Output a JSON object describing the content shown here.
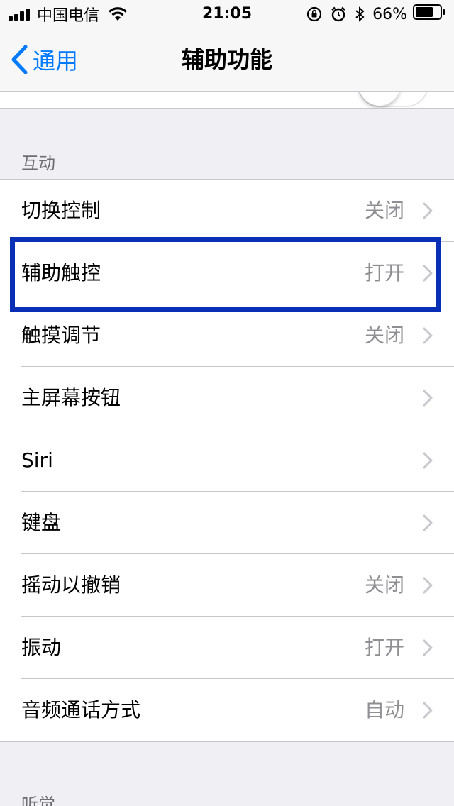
{
  "status_bar": {
    "carrier": "中国电信",
    "time": "21:05",
    "battery_percent": "66%",
    "icons": [
      "signal-icon",
      "wifi-icon",
      "orientation-lock-icon",
      "alarm-icon",
      "bluetooth-icon",
      "battery-icon"
    ]
  },
  "nav": {
    "back_label": "通用",
    "title": "辅助功能"
  },
  "sections": {
    "interaction_header": "互动",
    "hearing_header": "听觉"
  },
  "rows": [
    {
      "label": "切换控制",
      "value": "关闭"
    },
    {
      "label": "辅助触控",
      "value": "打开"
    },
    {
      "label": "触摸调节",
      "value": "关闭"
    },
    {
      "label": "主屏幕按钮",
      "value": ""
    },
    {
      "label": "Siri",
      "value": ""
    },
    {
      "label": "键盘",
      "value": ""
    },
    {
      "label": "摇动以撤销",
      "value": "关闭"
    },
    {
      "label": "振动",
      "value": "打开"
    },
    {
      "label": "音频通话方式",
      "value": "自动"
    }
  ],
  "colors": {
    "accent": "#007aff",
    "highlight": "#0a2fb7",
    "secondary_text": "#8e8e93",
    "background": "#efeff4"
  }
}
